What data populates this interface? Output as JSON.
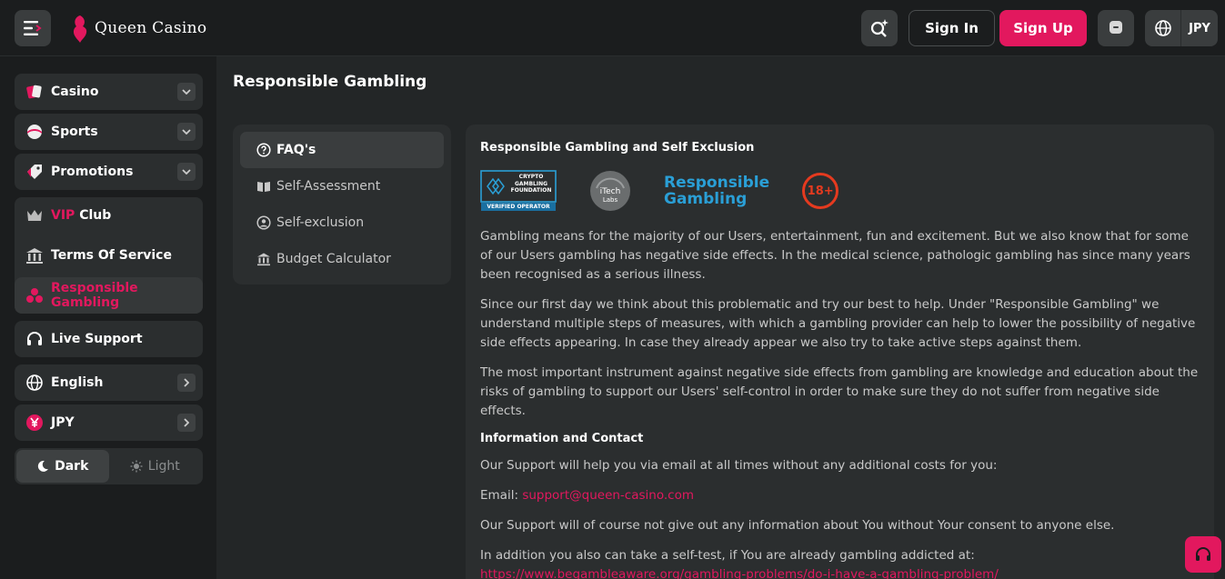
{
  "header": {
    "logo_text": "Queen Casino",
    "signin_label": "Sign In",
    "signup_label": "Sign Up",
    "currency": "JPY"
  },
  "sidebar": {
    "items": [
      {
        "label": "Casino"
      },
      {
        "label": "Sports"
      },
      {
        "label": "Promotions"
      },
      {
        "label_vip": "VIP",
        "label": "Club"
      },
      {
        "label": "Terms Of Service"
      },
      {
        "label": "Responsible Gambling"
      },
      {
        "label": "Live Support"
      },
      {
        "label": "English"
      },
      {
        "label": "JPY"
      }
    ],
    "theme_dark": "Dark",
    "theme_light": "Light"
  },
  "main": {
    "title": "Responsible Gambling",
    "faq_menu": [
      "FAQ's",
      "Self-Assessment",
      "Self-exclusion",
      "Budget Calculator"
    ],
    "heading": "Responsible Gambling and Self Exclusion",
    "logos": {
      "cgf_line1": "CRYPTO",
      "cgf_line2": "GAMBLING",
      "cgf_line3": "FOUNDATION",
      "cgf_line4": "VERIFIED OPERATOR",
      "itech1": "iTech",
      "itech2": "Labs",
      "rg1": "Responsible",
      "rg2": "Gambling",
      "age": "18+"
    },
    "p1": "Gambling means for the majority of our Users, entertainment, fun and excitement. But we also know that for some of our Users gambling has negative side effects. In the medical science, pathologic gambling has since many years been recognised as a serious illness.",
    "p2": "Since our first day we think about this problematic and try our best to help. Under \"Responsible Gambling\" we understand multiple steps of measures, with which a gambling provider can help to lower the possibility of negative side effects appearing. In case they already appear we also try to take active steps against them.",
    "p3": "The most important instrument against negative side effects from gambling are knowledge and education about the risks of gambling to support our Users' self-control in order to make sure they do not suffer from negative side effects.",
    "heading2": "Information and Contact",
    "p4": "Our Support will help you via email at all times without any additional costs for you:",
    "email_label": "Email:",
    "email": "support@queen-casino.com",
    "p5": "Our Support will of course not give out any information about You without Your consent to anyone else.",
    "p6": "In addition you also can take a self-test, if You are already gambling addicted at:",
    "test_link": "https://www.begambleaware.org/gambling-problems/do-i-have-a-gambling-problem/"
  },
  "colors": {
    "accent": "#e2185e",
    "bg": "#232627",
    "panel": "#2b2e2f"
  }
}
